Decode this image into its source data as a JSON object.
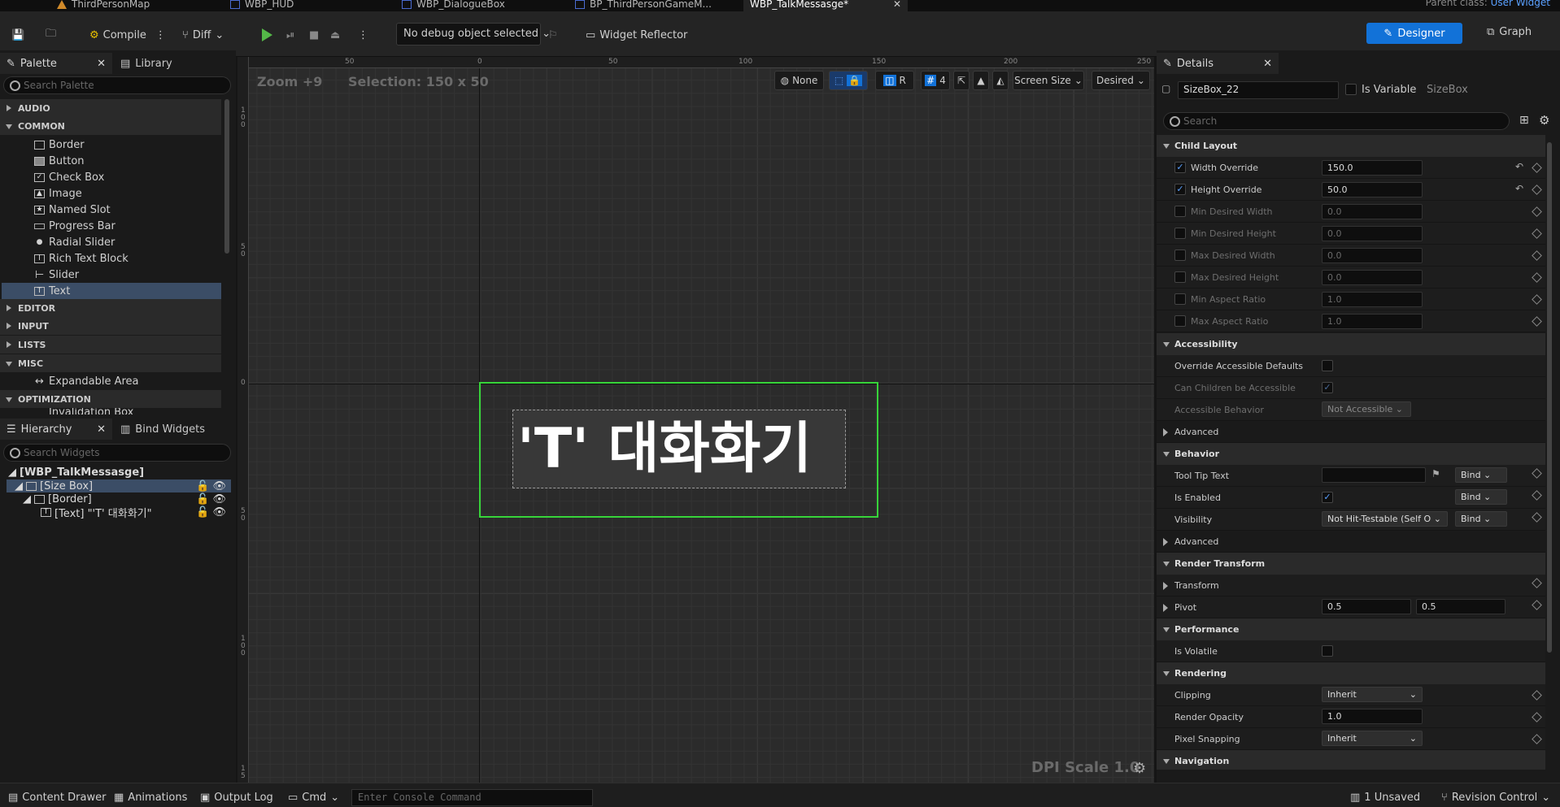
{
  "tabs": [
    {
      "label": "ThirdPersonMap",
      "active": false
    },
    {
      "label": "WBP_HUD",
      "active": false
    },
    {
      "label": "WBP_DialogueBox",
      "active": false
    },
    {
      "label": "BP_ThirdPersonGameM...",
      "active": false
    },
    {
      "label": "WBP_TalkMessasge*",
      "active": true
    }
  ],
  "parent_class": {
    "label": "Parent class:",
    "value": "User Widget"
  },
  "toolbar": {
    "compile": "Compile",
    "diff": "Diff",
    "debug_select": "No debug object selected",
    "widget_reflector": "Widget Reflector",
    "designer": "Designer",
    "graph": "Graph"
  },
  "palette": {
    "tab": "Palette",
    "library_tab": "Library",
    "search_placeholder": "Search Palette",
    "categories": [
      "AUDIO",
      "COMMON",
      "EDITOR",
      "INPUT",
      "LISTS",
      "MISC",
      "OPTIMIZATION"
    ],
    "common_items": [
      "Border",
      "Button",
      "Check Box",
      "Image",
      "Named Slot",
      "Progress Bar",
      "Radial Slider",
      "Rich Text Block",
      "Slider",
      "Text"
    ],
    "misc_items": [
      "Expandable Area"
    ],
    "optimization_items": [
      "Invalidation Box"
    ]
  },
  "hierarchy": {
    "tab": "Hierarchy",
    "bind_tab": "Bind Widgets",
    "search_placeholder": "Search Widgets",
    "root": "[WBP_TalkMessasge]",
    "items": [
      "[Size Box]",
      "[Border]",
      "[Text] \"'T'  대화화기\""
    ]
  },
  "viewport": {
    "zoom": "Zoom +9",
    "selection": "Selection: 150 x 50",
    "buttons": {
      "none": "None",
      "r": "R",
      "grid_size": "4",
      "screen_size": "Screen Size",
      "desired": "Desired"
    },
    "ruler_top": [
      "50",
      "0",
      "50",
      "100",
      "150",
      "200",
      "250"
    ],
    "ruler_left": [
      "1\n0\n0",
      "5\n0",
      "0",
      "5\n0",
      "1\n0\n0",
      "1\n5"
    ],
    "widget_text": "'T'  대화화기",
    "dpi": "DPI Scale 1.0"
  },
  "details": {
    "tab": "Details",
    "name": "SizeBox_22",
    "is_variable": "Is Variable",
    "class": "SizeBox",
    "search_placeholder": "Search",
    "sections": {
      "child_layout": "Child Layout",
      "accessibility": "Accessibility",
      "advanced": "Advanced",
      "behavior": "Behavior",
      "render_transform": "Render Transform",
      "performance": "Performance",
      "rendering": "Rendering",
      "navigation": "Navigation"
    },
    "child_layout": [
      {
        "label": "Width Override",
        "value": "150.0",
        "checked": true
      },
      {
        "label": "Height Override",
        "value": "50.0",
        "checked": true
      },
      {
        "label": "Min Desired Width",
        "value": "0.0",
        "checked": false
      },
      {
        "label": "Min Desired Height",
        "value": "0.0",
        "checked": false
      },
      {
        "label": "Max Desired Width",
        "value": "0.0",
        "checked": false
      },
      {
        "label": "Max Desired Height",
        "value": "0.0",
        "checked": false
      },
      {
        "label": "Min Aspect Ratio",
        "value": "1.0",
        "checked": false
      },
      {
        "label": "Max Aspect Ratio",
        "value": "1.0",
        "checked": false
      }
    ],
    "accessibility": {
      "override": "Override Accessible Defaults",
      "children": "Can Children be Accessible",
      "behavior": "Accessible Behavior",
      "behavior_value": "Not Accessible"
    },
    "behavior": {
      "tooltip": "Tool Tip Text",
      "enabled": "Is Enabled",
      "visibility": "Visibility",
      "visibility_value": "Not Hit-Testable (Self O",
      "bind": "Bind"
    },
    "render_transform": {
      "transform": "Transform",
      "pivot": "Pivot",
      "pivot_x": "0.5",
      "pivot_y": "0.5"
    },
    "performance": {
      "volatile": "Is Volatile"
    },
    "rendering": {
      "clipping": "Clipping",
      "clipping_value": "Inherit",
      "opacity": "Render Opacity",
      "opacity_value": "1.0",
      "snapping": "Pixel Snapping",
      "snapping_value": "Inherit"
    }
  },
  "bottom": {
    "content_drawer": "Content Drawer",
    "animations": "Animations",
    "output_log": "Output Log",
    "cmd": "Cmd",
    "console_placeholder": "Enter Console Command",
    "unsaved": "1 Unsaved",
    "revision": "Revision Control"
  },
  "colors": {
    "accent": "#1272d8",
    "selection_outline": "#37d43a",
    "play": "#54b848"
  }
}
